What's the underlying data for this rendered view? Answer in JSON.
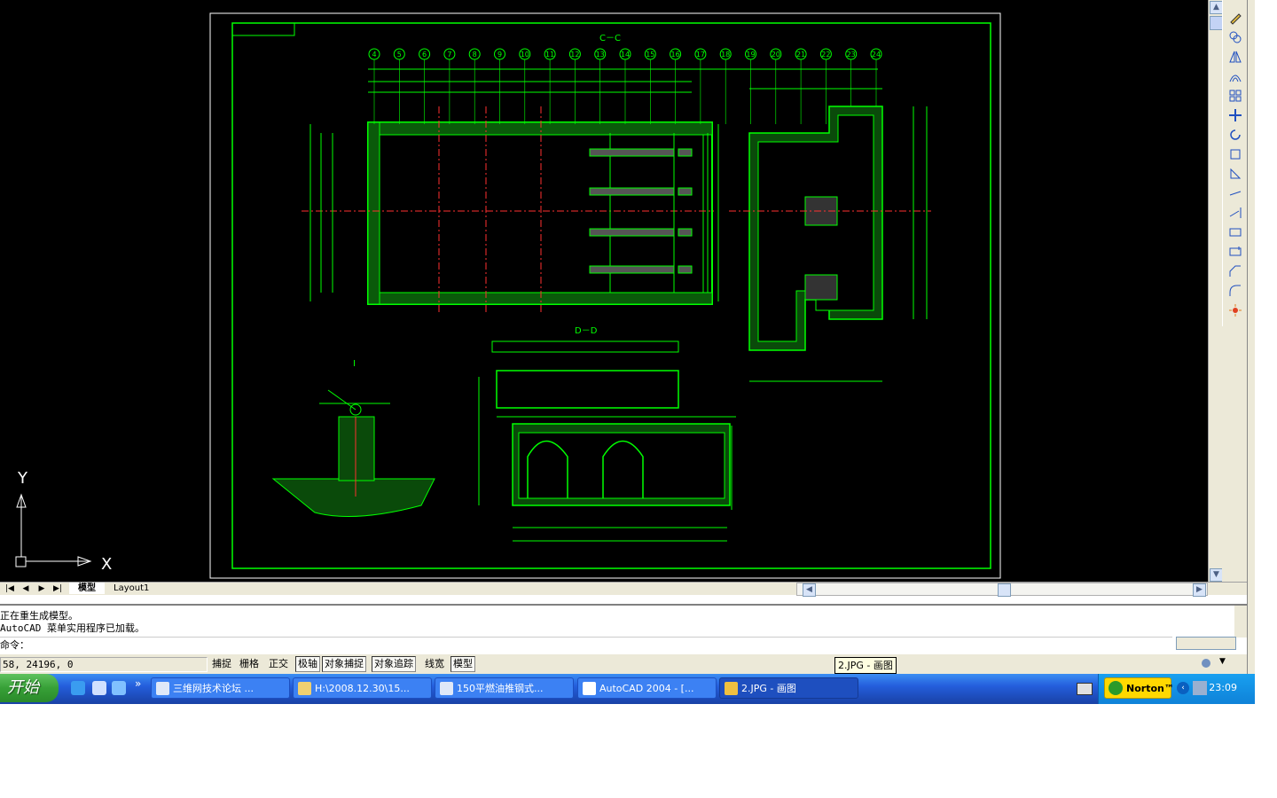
{
  "drawing": {
    "section_cc": "C－C",
    "section_dd": "D－D",
    "detail_i": "I",
    "axis_numbers": [
      "4",
      "5",
      "6",
      "7",
      "8",
      "9",
      "10",
      "11",
      "12",
      "13",
      "14",
      "15",
      "16",
      "17",
      "18",
      "19",
      "20",
      "21",
      "22",
      "23",
      "24"
    ],
    "ucs_x": "X",
    "ucs_y": "Y"
  },
  "tabs": {
    "model": "模型",
    "layout1": "Layout1"
  },
  "command": {
    "history_1": "正在重生成模型。",
    "history_2": "AutoCAD 菜单实用程序已加载。",
    "prompt": "命令："
  },
  "status": {
    "coords": "58, 24196, 0",
    "toggles": [
      "捕捉",
      "栅格",
      "正交",
      "极轴",
      "对象捕捉",
      "对象追踪",
      "线宽",
      "模型"
    ],
    "tooltip": "2.JPG - 画图"
  },
  "taskbar": {
    "start": "开始",
    "tasks": [
      "三维网技术论坛 ...",
      "H:\\2008.12.30\\15...",
      "150平燃油推钢式...",
      "AutoCAD 2004 - [...",
      "2.JPG - 画图"
    ],
    "norton": "Norton™",
    "clock": "23:09"
  },
  "colors": {
    "cad_line": "#00ff00",
    "canvas_bg": "#000000",
    "taskbar": "#245edc"
  }
}
